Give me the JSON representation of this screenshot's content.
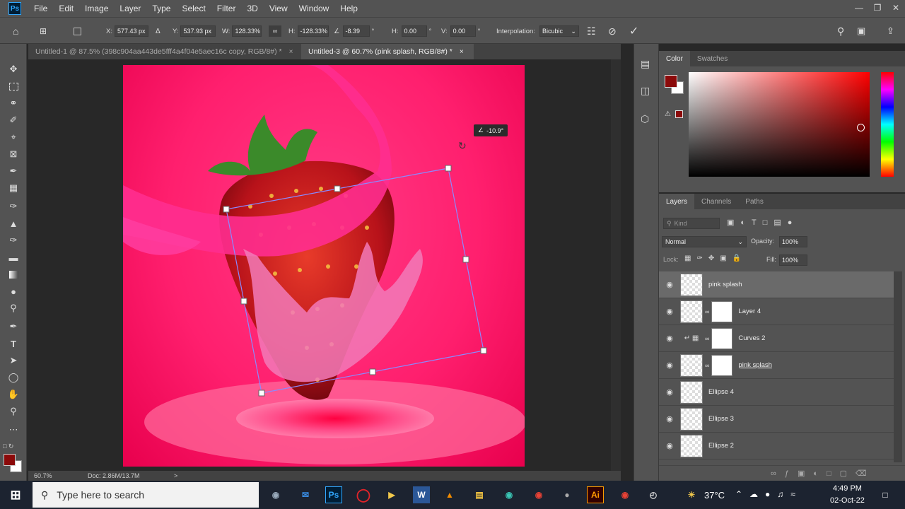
{
  "app": {
    "logo_text": "Ps"
  },
  "menu": [
    "File",
    "Edit",
    "Image",
    "Layer",
    "Type",
    "Select",
    "Filter",
    "3D",
    "View",
    "Window",
    "Help"
  ],
  "options": {
    "x_label": "X:",
    "x_value": "577.43 px",
    "y_label": "Y:",
    "y_value": "537.93 px",
    "w_label": "W:",
    "w_value": "128.33%",
    "h_label": "H:",
    "h_value": "-128.33%",
    "angle_value": "-8.39",
    "angle_unit": "°",
    "hskew_label": "H:",
    "hskew_value": "0.00",
    "vskew_label": "V:",
    "vskew_value": "0.00",
    "interp_label": "Interpolation:",
    "interp_value": "Bicubic"
  },
  "tabs": [
    {
      "label": "Untitled-1 @ 87.5% (398c904aa443de5fff4a4f04e5aec16c copy, RGB/8#) *",
      "close": "×"
    },
    {
      "label": "Untitled-3 @ 60.7% (pink splash, RGB/8#) *",
      "close": "×"
    }
  ],
  "canvas": {
    "rotation_readout": "-10.9°",
    "bg_color": "#ff1f6e"
  },
  "status": {
    "zoom": "60.7%",
    "doc": "Doc: 2.86M/13.7M",
    "arrow": ">"
  },
  "color_panel": {
    "tabs": [
      "Color",
      "Swatches"
    ],
    "foreground": "#8b0a0a"
  },
  "layers_panel": {
    "tabs": [
      "Layers",
      "Channels",
      "Paths"
    ],
    "kind_placeholder": "Kind",
    "blend_mode": "Normal",
    "opacity_label": "Opacity:",
    "opacity_value": "100%",
    "lock_label": "Lock:",
    "fill_label": "Fill:",
    "fill_value": "100%",
    "layers": [
      {
        "name": "pink splash"
      },
      {
        "name": "Layer 4"
      },
      {
        "name": "Curves 2"
      },
      {
        "name": "pink splash"
      },
      {
        "name": "Ellipse 4"
      },
      {
        "name": "Ellipse 3"
      },
      {
        "name": "Ellipse 2"
      }
    ]
  },
  "taskbar": {
    "search_placeholder": "Type here to search",
    "weather": "37°C",
    "time": "4:49 PM",
    "date": "02-Oct-22"
  }
}
